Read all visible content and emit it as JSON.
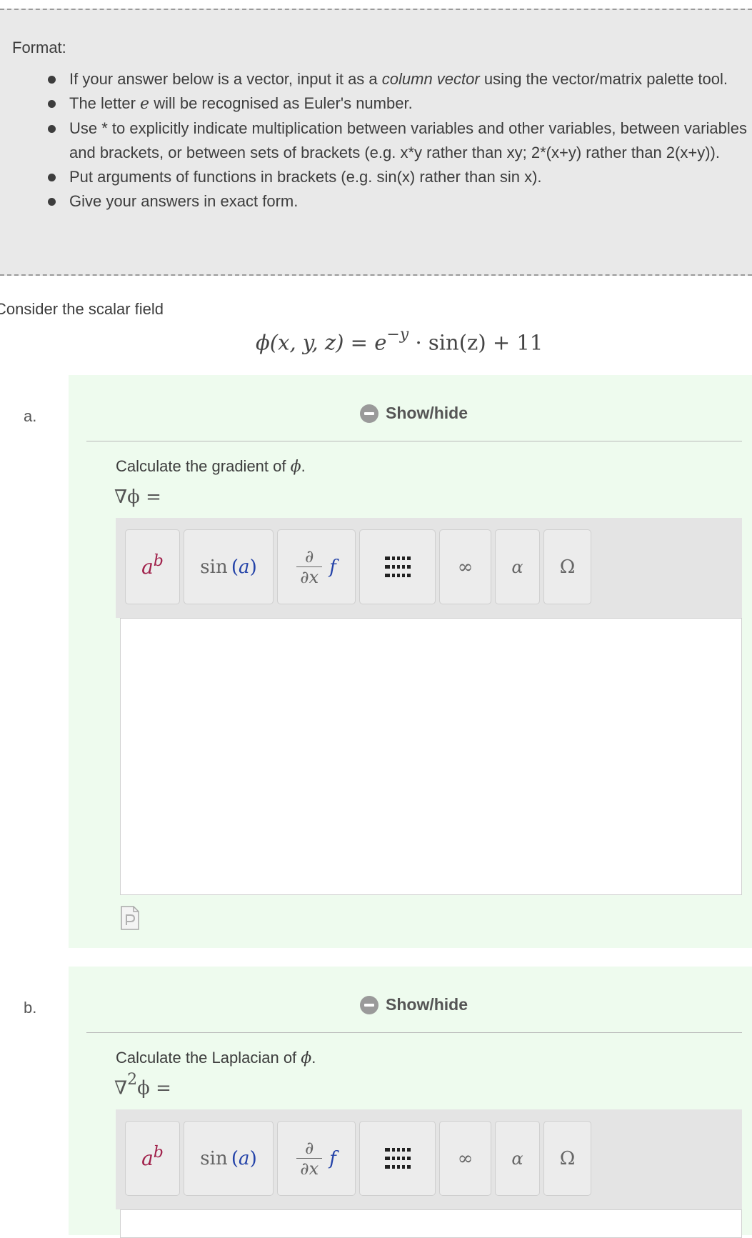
{
  "format": {
    "title": "Format:",
    "bullets": {
      "b0": {
        "pre": "If your answer below is a vector, input it as a ",
        "em": "column vector",
        "post": " using the vector/matrix palette tool."
      },
      "b1": {
        "pre": "The letter ",
        "math": "e",
        "post": " will be recognised as Euler's number."
      },
      "b2": "Use * to explicitly indicate multiplication between variables and other variables, between variables and brackets, or between sets of brackets (e.g. x*y rather than xy; 2*(x+y) rather than 2(x+y)).",
      "b3": "Put arguments of functions in brackets (e.g. sin(x) rather than sin x).",
      "b4": "Give your answers in exact form."
    }
  },
  "intro": "Consider the scalar field",
  "equation": {
    "phi": "ϕ",
    "args": "(x, y, z)",
    "eq": " = ",
    "e": "e",
    "exp": "−y",
    "rest": " · sin(z) + 11"
  },
  "parts": {
    "a": {
      "letter": "a.",
      "showhide": "Show/hide",
      "question_pre": "Calculate the gradient of ",
      "question_sym": "ϕ",
      "question_post": ".",
      "lhs": "∇ϕ ="
    },
    "b": {
      "letter": "b.",
      "showhide": "Show/hide",
      "question_pre": "Calculate the Laplacian of ",
      "question_sym": "ϕ",
      "question_post": ".",
      "lhs_nabla": "∇",
      "lhs_sup": "2",
      "lhs_rest": "ϕ ="
    }
  },
  "toolbar": {
    "power": {
      "base": "a",
      "exp": "b"
    },
    "function": {
      "name": "sin",
      "arg": "a"
    },
    "derivative": {
      "num": "∂",
      "den": "∂x",
      "f": "f"
    },
    "infinity": "∞",
    "greek": "α",
    "omega": "Ω"
  },
  "colors": {
    "panel": "#eefbee",
    "box": "#e9e9e9",
    "accent_red": "#a0204a",
    "accent_blue": "#2342a8"
  }
}
